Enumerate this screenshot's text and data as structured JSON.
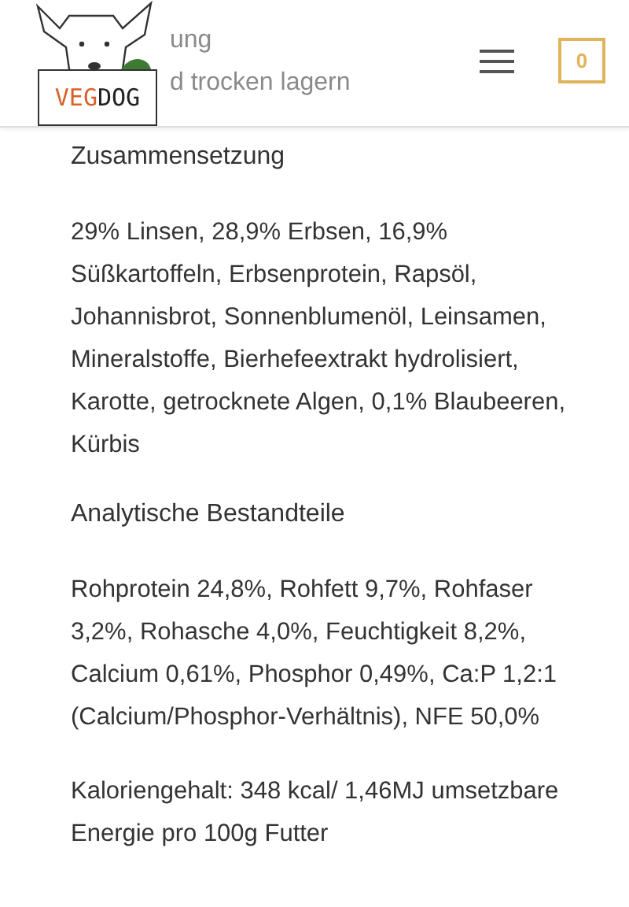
{
  "header": {
    "logo": {
      "part_1": "VEG",
      "part_2": "DOG"
    },
    "cart": {
      "count": "0"
    }
  },
  "hidden_lines": [
    "ung",
    "d trocken lagern"
  ],
  "sections": [
    {
      "heading": "Zusammensetzung",
      "paragraphs": [
        "29% Linsen, 28,9% Erbsen, 16,9% Süßkartoffeln, Erbsenprotein, Rapsöl, Johannisbrot, Sonnenblumenöl, Leinsamen, Mineralstoffe, Bierhefeextrakt hydrolisiert, Karotte, getrocknete Algen, 0,1% Blaubeeren, Kürbis"
      ]
    },
    {
      "heading": "Analytische Bestandteile",
      "paragraphs": [
        "Rohprotein 24,8%, Rohfett 9,7%, Rohfaser 3,2%, Rohasche 4,0%, Feuchtigkeit 8,2%, Calcium 0,61%, Phosphor 0,49%, Ca:P 1,2:1 (Calcium/Phosphor-Verhältnis), NFE 50,0%",
        "Kaloriengehalt: 348 kcal/ 1,46MJ umsetzbare Energie pro 100g Futter"
      ]
    }
  ]
}
